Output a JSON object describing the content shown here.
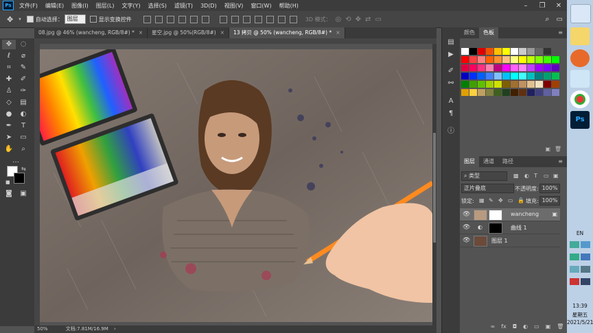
{
  "menu": [
    "文件(F)",
    "编辑(E)",
    "图像(I)",
    "图层(L)",
    "文字(Y)",
    "选择(S)",
    "滤镜(T)",
    "3D(D)",
    "视图(V)",
    "窗口(W)",
    "帮助(H)"
  ],
  "app_logo": "Ps",
  "options": {
    "auto_select_label": "自动选择：",
    "auto_select_value": "图层",
    "show_transform_label": "显示变换控件",
    "mode_3d": "3D 模式："
  },
  "tabs": [
    {
      "label": "08.jpg @ 46% (wancheng, RGB/8#) *",
      "active": false
    },
    {
      "label": "星空.jpg @ 50%(RGB/8#)",
      "active": false
    },
    {
      "label": "13 拷贝 @ 50% (wancheng, RGB/8#) *",
      "active": true
    }
  ],
  "status": {
    "zoom": "50%",
    "doc": "文档:7.81M/16.9M"
  },
  "swatches_panel": {
    "tab1": "颜色",
    "tab2": "色板"
  },
  "swatch_colors": [
    [
      "#ffffff",
      "#000000",
      "#e00000",
      "#f05000",
      "#ffc000",
      "#ffff00",
      "#ffffff",
      "#cccccc",
      "#999999",
      "#666666",
      "#333333"
    ],
    [
      "#ff0000",
      "#ff4040",
      "#ff8080",
      "#ff6000",
      "#ff9030",
      "#ffc080",
      "#ffff80",
      "#ffff00",
      "#c0ff00",
      "#80ff00",
      "#40ff00",
      "#00ff00"
    ],
    [
      "#e00040",
      "#ff0060",
      "#ff3080",
      "#ff80b0",
      "#c00080",
      "#ff00ff",
      "#ff60ff",
      "#ff80ff",
      "#c040ff",
      "#a000ff",
      "#8000ff",
      "#6000c0"
    ],
    [
      "#0000c0",
      "#0030ff",
      "#0060ff",
      "#4080ff",
      "#80c0ff",
      "#00c0ff",
      "#00ffff",
      "#40ffff",
      "#00c0c0",
      "#008080",
      "#00a070",
      "#00c050"
    ],
    [
      "#008000",
      "#40a000",
      "#60c000",
      "#a0d000",
      "#d0e000",
      "#806000",
      "#a07030",
      "#c09060",
      "#e0c090",
      "#f0e0c0",
      "#800000",
      "#a04000"
    ],
    [
      "#e0a000",
      "#ffd040",
      "#c0a060",
      "#808040",
      "#406020",
      "#204020",
      "#402000",
      "#603010",
      "#202060",
      "#404080",
      "#6060a0",
      "#8080c0"
    ]
  ],
  "layers_panel": {
    "tabs": [
      "图层",
      "通道",
      "路径"
    ],
    "filter": "类型",
    "blend_mode": "正片叠底",
    "opacity_label": "不透明度:",
    "opacity": "100%",
    "lock_label": "锁定:",
    "fill_label": "填充:",
    "fill": "100%",
    "layers": [
      {
        "name": "wancheng"
      },
      {
        "name": "曲线 1"
      },
      {
        "name": "图层 1"
      }
    ]
  },
  "taskbar": {
    "lang": "EN",
    "time": "13:39",
    "weekday": "星期五",
    "date": "2021/5/21",
    "ps_label": "Ps"
  }
}
